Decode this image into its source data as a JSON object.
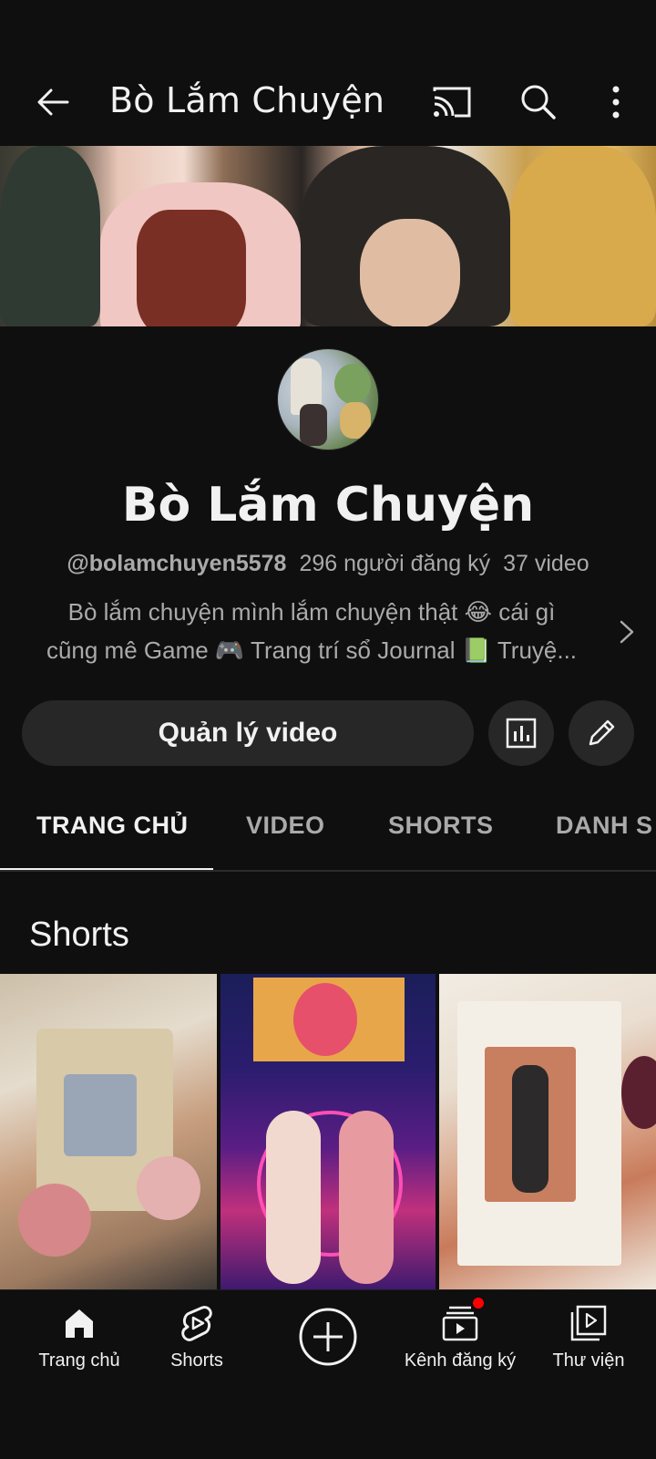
{
  "app_bar": {
    "title": "Bò Lắm Chuyện",
    "icons": [
      "back-arrow-icon",
      "cast-icon",
      "search-icon",
      "more-vert-icon"
    ]
  },
  "channel": {
    "name": "Bò Lắm Chuyện",
    "handle": "@bolamchuyen5578",
    "subscribers": "296 người đăng ký",
    "videos": "37 video",
    "description_line1": "Bò lắm chuyện mình lắm chuyện thật 😂 cái gì",
    "description_line2": "cũng mê  Game 🎮  Trang trí sổ Journal 📗 Truyệ..."
  },
  "actions": {
    "manage_label": "Quản lý video"
  },
  "tabs": [
    {
      "label": "TRANG CHỦ",
      "active": true
    },
    {
      "label": "VIDEO",
      "active": false
    },
    {
      "label": "SHORTS",
      "active": false
    },
    {
      "label": "DANH S",
      "active": false
    }
  ],
  "shorts_section": {
    "title": "Shorts"
  },
  "bottom_nav": [
    {
      "label": "Trang chủ",
      "icon": "home-icon"
    },
    {
      "label": "Shorts",
      "icon": "shorts-icon"
    },
    {
      "label": "",
      "icon": "create-plus-icon"
    },
    {
      "label": "Kênh đăng ký",
      "icon": "subscriptions-icon"
    },
    {
      "label": "Thư viện",
      "icon": "library-icon"
    }
  ],
  "colors": {
    "background": "#0f0f0f",
    "button_bg": "#272727",
    "secondary_text": "#aaaaaa",
    "notification_dot": "#ff0000"
  }
}
